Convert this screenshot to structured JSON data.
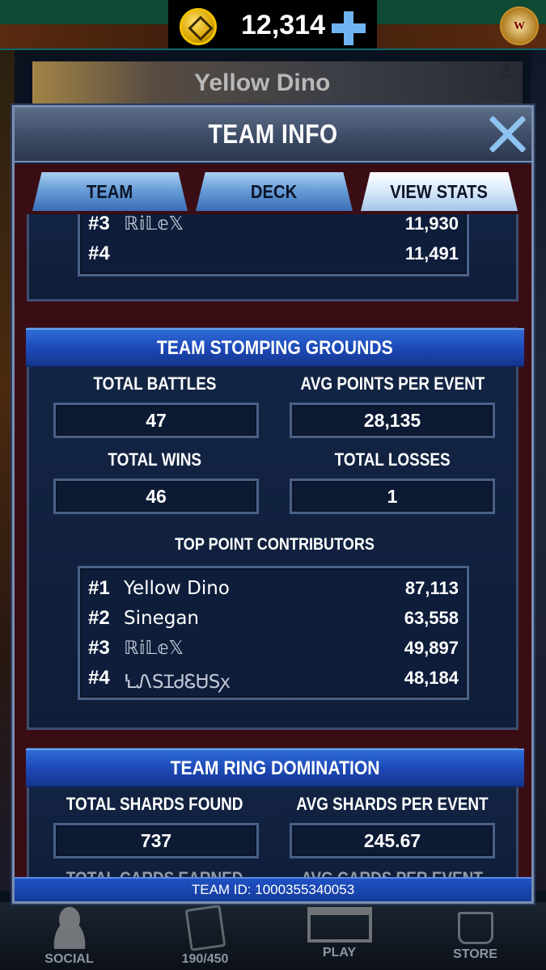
{
  "top_bar": {
    "coins": "12,314",
    "add_coins_icon": "plus-icon",
    "badge_icon": "wwe-crest-icon",
    "badge_text": "W"
  },
  "background": {
    "header_name": "Yellow Dino",
    "warning_icon": "warning-icon"
  },
  "modal": {
    "title": "TEAM INFO",
    "close_icon": "close-icon",
    "tabs": [
      {
        "label": "TEAM",
        "active": false
      },
      {
        "label": "DECK",
        "active": false
      },
      {
        "label": "VIEW STATS",
        "active": true
      }
    ],
    "top_list": [
      {
        "rank": "#3",
        "name": "ℝ𝕚𝕃𝕖𝕏",
        "score": "11,930"
      },
      {
        "rank": "#4",
        "name": "",
        "score": "11,491"
      }
    ],
    "stomping": {
      "title": "TEAM STOMPING GROUNDS",
      "total_battles_label": "TOTAL BATTLES",
      "total_battles": "47",
      "avg_points_label": "AVG POINTS PER EVENT",
      "avg_points": "28,135",
      "total_wins_label": "TOTAL WINS",
      "total_wins": "46",
      "total_losses_label": "TOTAL LOSSES",
      "total_losses": "1",
      "contributors_label": "TOP POINT CONTRIBUTORS",
      "contributors": [
        {
          "rank": "#1",
          "name": "Yellow Dino",
          "score": "87,113"
        },
        {
          "rank": "#2",
          "name": "Sinegan",
          "score": "63,558"
        },
        {
          "rank": "#3",
          "name": "ℝ𝕚𝕃𝕖𝕏",
          "score": "49,897"
        },
        {
          "rank": "#4",
          "name": "ꝆᏁЅꞮᏧᏋᏌЅꭗ",
          "score": "48,184"
        }
      ]
    },
    "ring": {
      "title": "TEAM RING DOMINATION",
      "total_shards_label": "TOTAL SHARDS FOUND",
      "total_shards": "737",
      "avg_shards_label": "AVG SHARDS PER EVENT",
      "avg_shards": "245.67",
      "total_cards_label": "TOTAL CARDS EARNED",
      "avg_cards_label": "AVG CARDS PER EVENT"
    },
    "footer": "TEAM ID: 1000355340053"
  },
  "bottom_nav": [
    {
      "label": "SOCIAL",
      "icon": "social-icon"
    },
    {
      "label": "190/450",
      "icon": "cards-icon"
    },
    {
      "label": "PLAY",
      "icon": "ring-icon"
    },
    {
      "label": "STORE",
      "icon": "store-icon"
    }
  ]
}
